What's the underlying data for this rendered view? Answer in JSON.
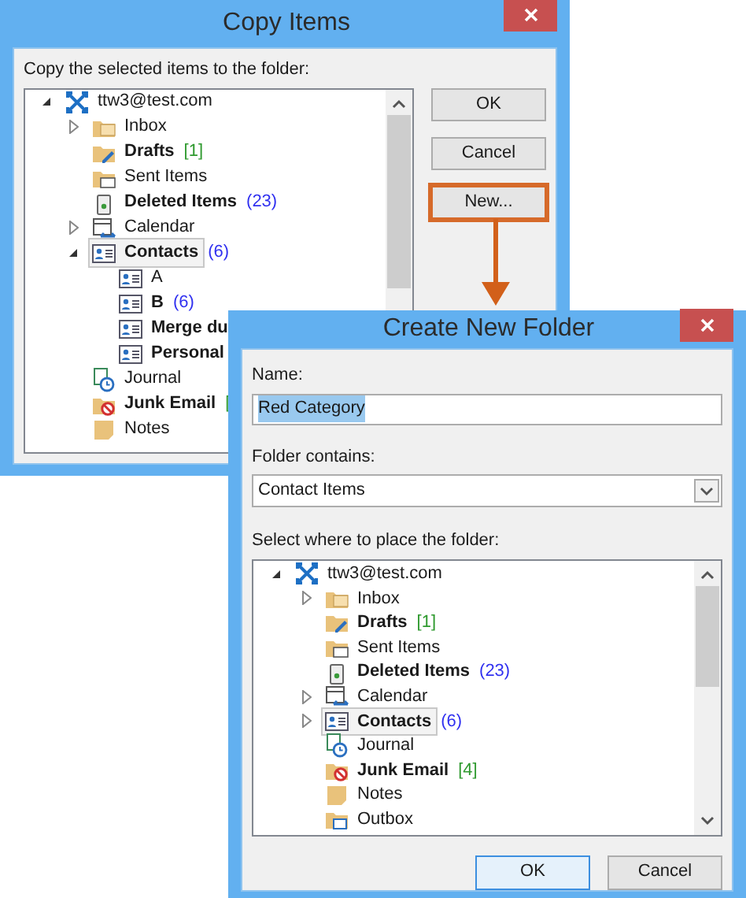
{
  "copy_dialog": {
    "title": "Copy Items",
    "prompt": "Copy the selected items to the folder:",
    "tree": [
      {
        "name": "ttw3@test.com",
        "kind": "account",
        "bold": false,
        "selected": false,
        "expanded": true,
        "children": [
          {
            "name": "Inbox",
            "kind": "inbox",
            "bold": false,
            "selected": false,
            "expanded": false
          },
          {
            "name": "Drafts",
            "kind": "drafts",
            "bold": true,
            "selected": false,
            "count": "[1]",
            "color": "#2f9a2f"
          },
          {
            "name": "Sent Items",
            "kind": "sent",
            "bold": false,
            "selected": false
          },
          {
            "name": "Deleted Items",
            "kind": "deleted",
            "bold": true,
            "selected": false,
            "count": "(23)",
            "color": "#3030f0"
          },
          {
            "name": "Calendar",
            "kind": "calendar",
            "bold": false,
            "selected": false,
            "expanded": false
          },
          {
            "name": "Contacts",
            "kind": "contacts",
            "bold": true,
            "selected": true,
            "count": "(6)",
            "color": "#3030f0",
            "expanded": true,
            "children": [
              {
                "name": "A",
                "kind": "contacts",
                "bold": false,
                "selected": false
              },
              {
                "name": "B",
                "kind": "contacts",
                "bold": true,
                "selected": false,
                "count": "(6)",
                "color": "#3030f0"
              },
              {
                "name": "Merge du",
                "kind": "contacts",
                "bold": true,
                "selected": false
              },
              {
                "name": "Personal",
                "kind": "contacts",
                "bold": true,
                "selected": false
              }
            ]
          },
          {
            "name": "Journal",
            "kind": "journal",
            "bold": false,
            "selected": false
          },
          {
            "name": "Junk Email",
            "kind": "junk",
            "bold": true,
            "selected": false,
            "count": "[",
            "color": "#2f9a2f"
          },
          {
            "name": "Notes",
            "kind": "notes",
            "bold": false,
            "selected": false
          }
        ]
      }
    ],
    "buttons": [
      {
        "label": "OK",
        "highlighted": false
      },
      {
        "label": "Cancel",
        "highlighted": false
      },
      {
        "label": "New...",
        "highlighted": true
      }
    ]
  },
  "new_folder_dialog": {
    "title": "Create New Folder",
    "name_label": "Name:",
    "name_value": "Red Category",
    "name_text_selected": true,
    "contains_label": "Folder contains:",
    "contains_value": "Contact Items",
    "place_label": "Select where to place the folder:",
    "tree": [
      {
        "name": "ttw3@test.com",
        "kind": "account",
        "bold": false,
        "selected": false,
        "expanded": true,
        "children": [
          {
            "name": "Inbox",
            "kind": "inbox",
            "bold": false,
            "selected": false,
            "expanded": false
          },
          {
            "name": "Drafts",
            "kind": "drafts",
            "bold": true,
            "selected": false,
            "count": "[1]",
            "color": "#2f9a2f"
          },
          {
            "name": "Sent Items",
            "kind": "sent",
            "bold": false,
            "selected": false
          },
          {
            "name": "Deleted Items",
            "kind": "deleted",
            "bold": true,
            "selected": false,
            "count": "(23)",
            "color": "#3030f0"
          },
          {
            "name": "Calendar",
            "kind": "calendar",
            "bold": false,
            "selected": false,
            "expanded": false
          },
          {
            "name": "Contacts",
            "kind": "contacts",
            "bold": true,
            "selected": true,
            "count": "(6)",
            "color": "#3030f0",
            "expanded": false
          },
          {
            "name": "Journal",
            "kind": "journal",
            "bold": false,
            "selected": false
          },
          {
            "name": "Junk Email",
            "kind": "junk",
            "bold": true,
            "selected": false,
            "count": "[4]",
            "color": "#2f9a2f"
          },
          {
            "name": "Notes",
            "kind": "notes",
            "bold": false,
            "selected": false
          },
          {
            "name": "Outbox",
            "kind": "outbox",
            "bold": false,
            "selected": false
          }
        ]
      }
    ],
    "buttons": [
      {
        "label": "OK",
        "default": true
      },
      {
        "label": "Cancel",
        "default": false
      }
    ]
  }
}
